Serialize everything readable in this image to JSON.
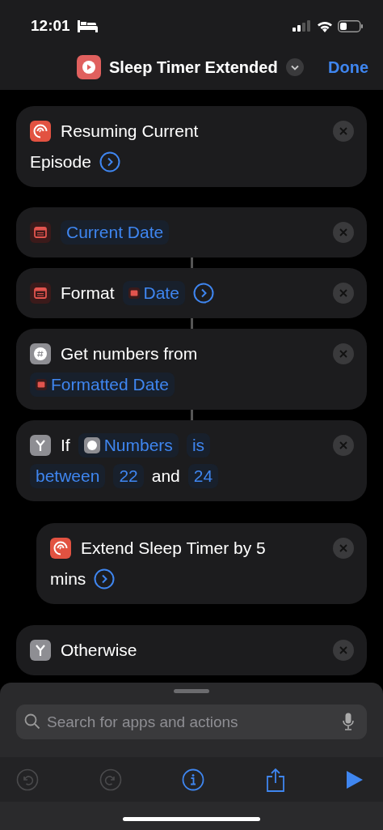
{
  "status_bar": {
    "time": "12:01"
  },
  "nav": {
    "title": "Sleep Timer Extended",
    "done": "Done"
  },
  "actions": [
    {
      "kind": "podcast",
      "connected": false,
      "lines": [
        [
          {
            "kind": "text",
            "text": "Resuming Current"
          }
        ],
        [
          {
            "kind": "text",
            "text": "Episode"
          },
          {
            "kind": "arrow"
          }
        ]
      ]
    },
    {
      "kind": "date",
      "connected": false,
      "lines": [
        [
          {
            "kind": "token",
            "text": "Current Date"
          }
        ]
      ]
    },
    {
      "kind": "date",
      "connected": true,
      "lines": [
        [
          {
            "kind": "text",
            "text": "Format"
          },
          {
            "kind": "date-token",
            "text": "Date"
          },
          {
            "kind": "arrow"
          }
        ]
      ]
    },
    {
      "kind": "number",
      "connected": true,
      "lines": [
        [
          {
            "kind": "text",
            "text": "Get numbers from"
          }
        ],
        [
          {
            "kind": "date-token",
            "text": "Formatted Date"
          }
        ]
      ]
    },
    {
      "kind": "branch",
      "connected": true,
      "lines": [
        [
          {
            "kind": "text",
            "text": "If"
          },
          {
            "kind": "number-token",
            "text": "Numbers"
          },
          {
            "kind": "token",
            "text": "is"
          }
        ],
        [
          {
            "kind": "token",
            "text": "between"
          },
          {
            "kind": "token",
            "text": "22"
          },
          {
            "kind": "text",
            "text": "and"
          },
          {
            "kind": "token",
            "text": "24"
          }
        ]
      ],
      "children": [
        {
          "kind": "podcast",
          "connected": false,
          "lines": [
            [
              {
                "kind": "text",
                "text": "Extend Sleep Timer by 5"
              }
            ],
            [
              {
                "kind": "text",
                "text": "mins"
              },
              {
                "kind": "arrow"
              }
            ]
          ]
        }
      ]
    },
    {
      "kind": "branch",
      "connected": false,
      "lines": [
        [
          {
            "kind": "text",
            "text": "Otherwise"
          }
        ]
      ]
    }
  ],
  "search": {
    "placeholder": "Search for apps and actions"
  },
  "toolbar": [
    {
      "kind": "undo",
      "disabled": true
    },
    {
      "kind": "redo",
      "disabled": true
    },
    {
      "kind": "info",
      "disabled": false
    },
    {
      "kind": "share",
      "disabled": false
    },
    {
      "kind": "play",
      "disabled": false
    }
  ]
}
